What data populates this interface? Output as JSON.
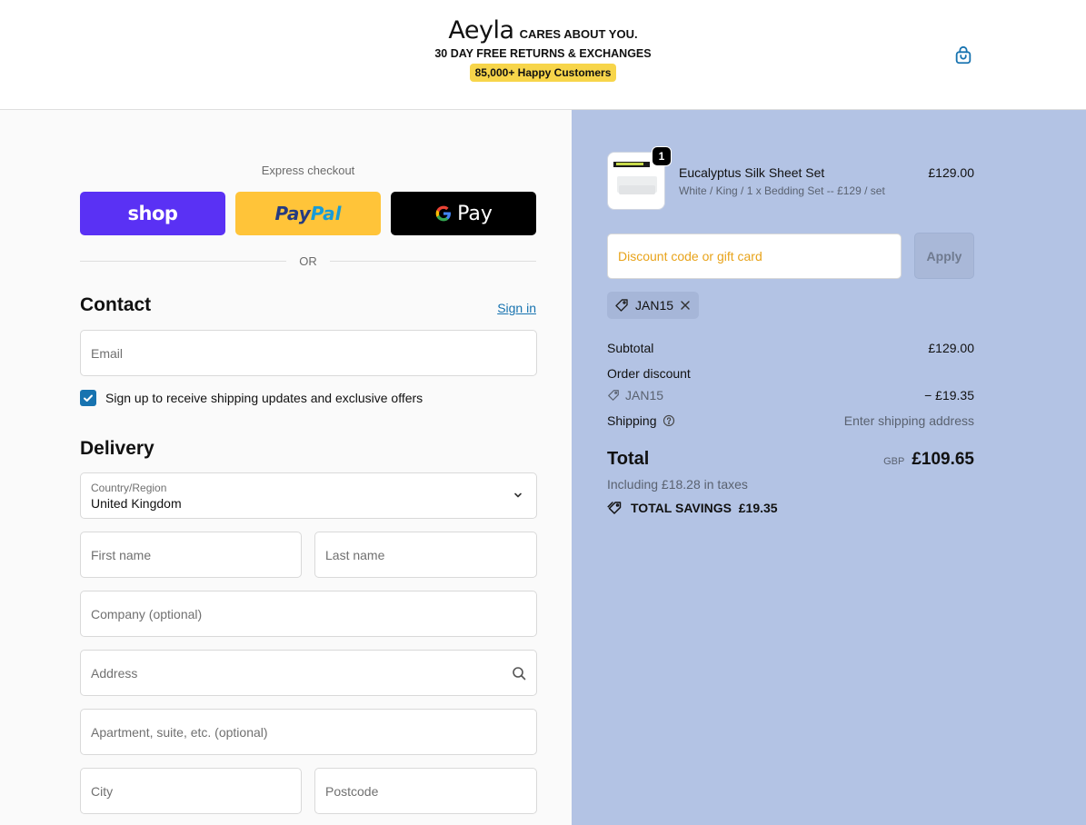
{
  "header": {
    "logo": "Aeyla",
    "tagline": "CARES ABOUT YOU.",
    "returns": "30 DAY FREE RETURNS & EXCHANGES",
    "badge": "85,000+ Happy Customers"
  },
  "express": {
    "label": "Express checkout",
    "shop_label": "shop",
    "paypal_label_1": "Pay",
    "paypal_label_2": "Pal",
    "gpay_label": "Pay",
    "or_label": "OR"
  },
  "contact": {
    "title": "Contact",
    "signin": "Sign in",
    "email_placeholder": "Email",
    "consent": "Sign up to receive shipping updates and exclusive offers",
    "consent_checked": true
  },
  "delivery": {
    "title": "Delivery",
    "country_label": "Country/Region",
    "country_value": "United Kingdom",
    "first_name": "First name",
    "last_name": "Last name",
    "company": "Company (optional)",
    "address": "Address",
    "apartment": "Apartment, suite, etc. (optional)",
    "city": "City",
    "postcode": "Postcode"
  },
  "order": {
    "product": {
      "quantity": "1",
      "name": "Eucalyptus Silk Sheet Set",
      "variant": "White / King / 1 x Bedding Set -- £129 / set",
      "price": "£129.00"
    },
    "discount_placeholder": "Discount code or gift card",
    "apply_label": "Apply",
    "applied_code": "JAN15",
    "subtotal_label": "Subtotal",
    "subtotal_value": "£129.00",
    "order_discount_label": "Order discount",
    "discount_code": "JAN15",
    "discount_value": "− £19.35",
    "shipping_label": "Shipping",
    "shipping_value": "Enter shipping address",
    "total_label": "Total",
    "currency": "GBP",
    "total_value": "£109.65",
    "taxes": "Including £18.28 in taxes",
    "savings": "TOTAL SAVINGS  £19.35"
  },
  "colors": {
    "accent": "#1773b0",
    "summary_bg": "#b3c3e4",
    "badge_yellow": "#f7d54a",
    "shop_purple": "#5a31f4",
    "paypal_yellow": "#ffc439"
  }
}
